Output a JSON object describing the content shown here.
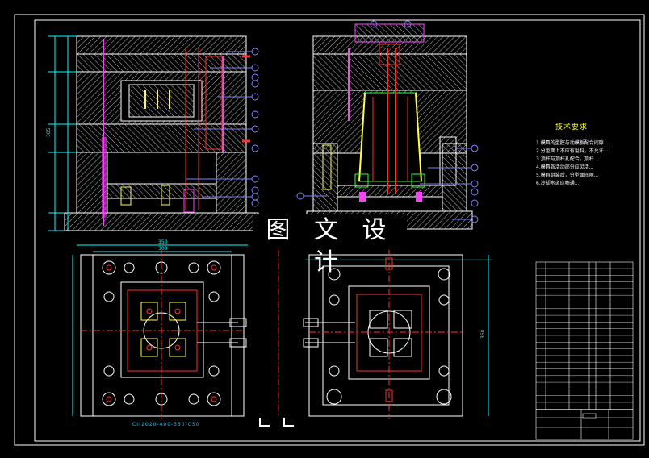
{
  "watermark": "图 文 设 计",
  "notes": {
    "title": "技术要求",
    "lines": [
      "1.模具的型腔与动模板配合间隙...",
      "2.分型面上不应有溢料，不允许...",
      "3.顶杆与顶杆孔配合，顶杆...",
      "4.模具各活动部分应灵活...",
      "5.模具组装后，分型面间隙...",
      "6.冷却水道应畅通..."
    ]
  },
  "caption": "CI-2020-400-350-CS0",
  "dimensions": {
    "width_top_outer": "350",
    "width_top_inner": "300",
    "height_bottom_right": "350",
    "height_left_total": "305"
  },
  "colors": {
    "frame": "#ffffff",
    "hatch": "#c8c8c8",
    "dimension": "#00ffff",
    "part": "#ff3030",
    "magenta": "#ff40ff",
    "yellow": "#ffff40",
    "green": "#30ff30",
    "balloon": "#8080ff"
  }
}
